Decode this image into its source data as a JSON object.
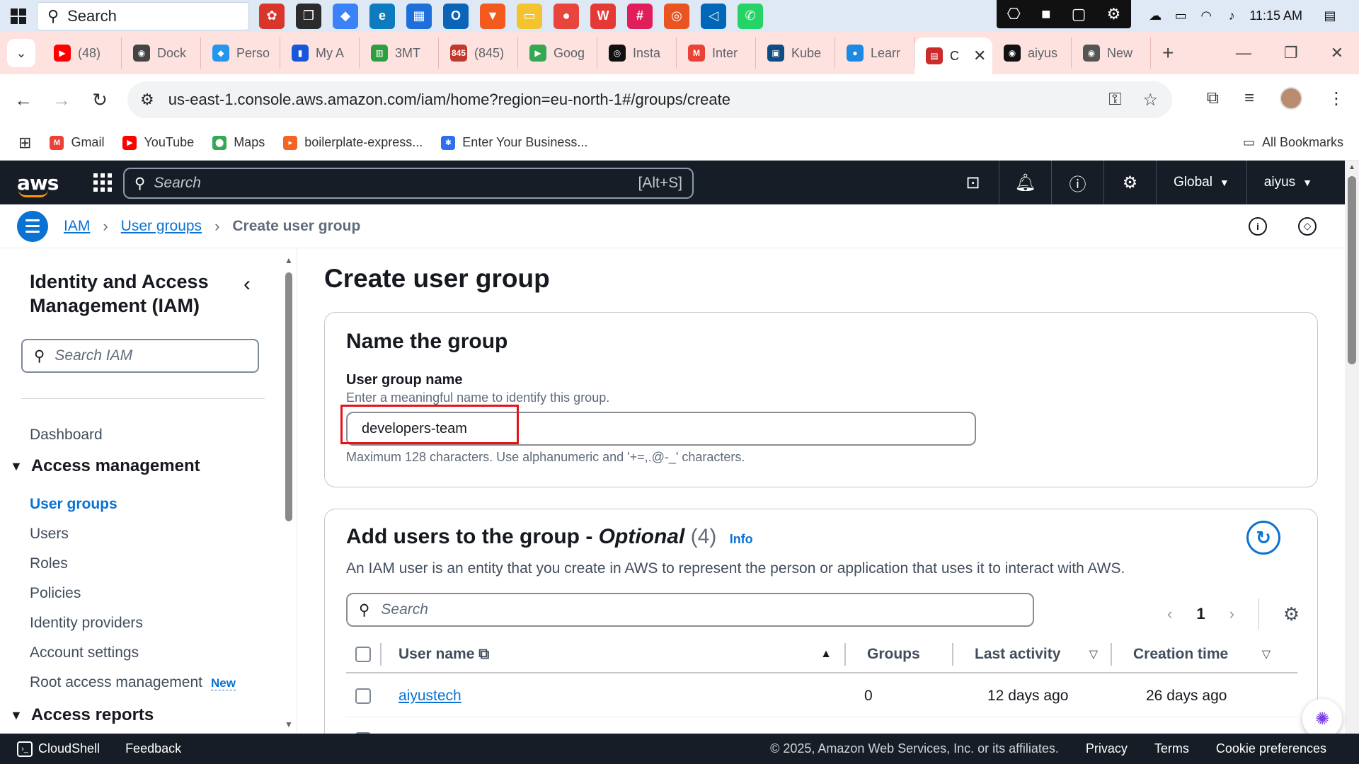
{
  "taskbar": {
    "search_placeholder": "Search",
    "apps": [
      {
        "name": "app-1",
        "color": "#d9362b",
        "glyph": "✿"
      },
      {
        "name": "task-view",
        "color": "#2b2b2b",
        "glyph": "❐"
      },
      {
        "name": "copilot",
        "color": "#3b82f6",
        "glyph": "◆"
      },
      {
        "name": "edge",
        "color": "#0f7bbf",
        "glyph": "e"
      },
      {
        "name": "store",
        "color": "#1e6fd9",
        "glyph": "▦"
      },
      {
        "name": "outlook",
        "color": "#0a64b8",
        "glyph": "O"
      },
      {
        "name": "brave",
        "color": "#f25a1e",
        "glyph": "▼"
      },
      {
        "name": "file-explorer",
        "color": "#f4c430",
        "glyph": "▭"
      },
      {
        "name": "chrome",
        "color": "#e8453c",
        "glyph": "●"
      },
      {
        "name": "wps",
        "color": "#e53935",
        "glyph": "W"
      },
      {
        "name": "slack",
        "color": "#e01e5a",
        "glyph": "#"
      },
      {
        "name": "ubuntu",
        "color": "#e95420",
        "glyph": "◎"
      },
      {
        "name": "vscode",
        "color": "#0066b8",
        "glyph": "◁"
      },
      {
        "name": "whatsapp",
        "color": "#25d366",
        "glyph": "✆"
      }
    ],
    "time": "11:15 AM"
  },
  "browser": {
    "tabs": [
      {
        "label": "(48) ",
        "color": "#ff0000",
        "glyph": "▶"
      },
      {
        "label": "Dock",
        "color": "#444444",
        "glyph": "◉"
      },
      {
        "label": "Perso",
        "color": "#2496ed",
        "glyph": "◆"
      },
      {
        "label": "My A",
        "color": "#1a56db",
        "glyph": "▮"
      },
      {
        "label": "3MT",
        "color": "#2e9e3e",
        "glyph": "▥"
      },
      {
        "label": "(845)",
        "color": "#c0392b",
        "glyph": "845"
      },
      {
        "label": "Goog",
        "color": "#34a853",
        "glyph": "▶"
      },
      {
        "label": "Insta",
        "color": "#111111",
        "glyph": "◎"
      },
      {
        "label": "Inter",
        "color": "#ea4335",
        "glyph": "M"
      },
      {
        "label": "Kube",
        "color": "#0f4c81",
        "glyph": "▣"
      },
      {
        "label": "Learr",
        "color": "#1e88e5",
        "glyph": "●"
      }
    ],
    "active_tab": {
      "label": "C",
      "color": "#cc2b2b",
      "glyph": "▤"
    },
    "tabs_after": [
      {
        "label": "aiyus",
        "color": "#111111",
        "glyph": "◉"
      },
      {
        "label": "New",
        "color": "#555555",
        "glyph": "◉"
      }
    ],
    "url": "us-east-1.console.aws.amazon.com/iam/home?region=eu-north-1#/groups/create",
    "bookmarks": [
      {
        "label": "Gmail",
        "color": "#ea4335",
        "glyph": "M"
      },
      {
        "label": "YouTube",
        "color": "#ff0000",
        "glyph": "▶"
      },
      {
        "label": "Maps",
        "color": "#34a853",
        "glyph": "⬤"
      },
      {
        "label": "boilerplate-express...",
        "color": "#f26522",
        "glyph": "▸"
      },
      {
        "label": "Enter Your Business...",
        "color": "#2f6fed",
        "glyph": "✱"
      }
    ],
    "all_bookmarks": "All Bookmarks"
  },
  "aws": {
    "logo": "aws",
    "search_placeholder": "Search",
    "search_shortcut": "[Alt+S]",
    "region": "Global",
    "user": "aiyus",
    "breadcrumb": {
      "root": "IAM",
      "middle": "User groups",
      "current": "Create user group"
    }
  },
  "sidebar": {
    "title": "Identity and Access Management (IAM)",
    "search_placeholder": "Search IAM",
    "dashboard": "Dashboard",
    "section1": "Access management",
    "items": [
      "User groups",
      "Users",
      "Roles",
      "Policies",
      "Identity providers",
      "Account settings",
      "Root access management"
    ],
    "new_badge": "New",
    "section2": "Access reports"
  },
  "main": {
    "page_title": "Create user group",
    "name_card": {
      "heading": "Name the group",
      "label": "User group name",
      "description": "Enter a meaningful name to identify this group.",
      "value": "developers-team",
      "constraint": "Maximum 128 characters. Use alphanumeric and '+=,.@-_' characters."
    },
    "users_card": {
      "heading_main": "Add users to the group - ",
      "heading_optional": "Optional",
      "count": "(4)",
      "info": "Info",
      "description": "An IAM user is an entity that you create in AWS to represent the person or application that uses it to interact with AWS.",
      "search_placeholder": "Search",
      "page": "1",
      "columns": [
        "User name",
        "Groups",
        "Last activity",
        "Creation time"
      ],
      "rows": [
        {
          "user": "aiyustech",
          "groups": "0",
          "last_activity": "12 days ago",
          "created": "26 days ago"
        }
      ]
    }
  },
  "footer": {
    "cloudshell": "CloudShell",
    "feedback": "Feedback",
    "copyright": "© 2025, Amazon Web Services, Inc. or its affiliates.",
    "privacy": "Privacy",
    "terms": "Terms",
    "cookies": "Cookie preferences"
  }
}
